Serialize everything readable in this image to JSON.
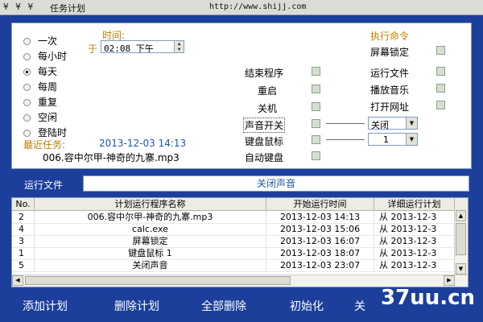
{
  "titlebar": {
    "icons_text": "¥ ¥ ¥",
    "title": "任务计划",
    "url": "http://www.shijj.com"
  },
  "schedule": {
    "time_label": "时间:",
    "at_label": "于",
    "time_value": "02:08 下午",
    "spin_up": "▲",
    "spin_down": "▼",
    "options": [
      {
        "label": "一次",
        "selected": false
      },
      {
        "label": "每小时",
        "selected": false
      },
      {
        "label": "每天",
        "selected": true
      },
      {
        "label": "每周",
        "selected": false
      },
      {
        "label": "重复",
        "selected": false
      },
      {
        "label": "空闲",
        "selected": false
      },
      {
        "label": "登陆时",
        "selected": false
      }
    ],
    "recent_label": "最近任务:",
    "recent_datetime": "2013-12-03   14:13",
    "recent_file": "006.容中尔甲-神奇的九寨.mp3"
  },
  "actions_mid": [
    {
      "label": "结束程序"
    },
    {
      "label": "重启"
    },
    {
      "label": "关机"
    },
    {
      "label": "声音开关"
    },
    {
      "label": "键盘鼠标"
    },
    {
      "label": "自动键盘"
    }
  ],
  "actions_right": {
    "header": "执行命令",
    "items": [
      {
        "label": "屏幕锁定"
      },
      {
        "label": "运行文件"
      },
      {
        "label": "播放音乐"
      },
      {
        "label": "打开网址"
      }
    ],
    "sound_select": "关闭",
    "kbd_select": "1",
    "dropdown_glyph": "▼"
  },
  "run_file": {
    "label": "运行文件",
    "value": "关闭声音"
  },
  "table": {
    "headers": [
      "No.",
      "计划运行程序名称",
      "开始运行时间",
      "详细运行计划"
    ],
    "rows": [
      {
        "no": "2",
        "name": "006.容中尔甲-神奇的九寨.mp3",
        "time": "2013-12-03   14:13",
        "detail": "从 2013-12-3"
      },
      {
        "no": "4",
        "name": "calc.exe",
        "time": "2013-12-03   15:06",
        "detail": "从 2013-12-3"
      },
      {
        "no": "3",
        "name": "屏幕锁定",
        "time": "2013-12-03   16:07",
        "detail": "从 2013-12-3"
      },
      {
        "no": "1",
        "name": "键盘鼠标 1",
        "time": "2013-12-03   18:07",
        "detail": "从 2013-12-3"
      },
      {
        "no": "5",
        "name": "关闭声音",
        "time": "2013-12-03   23:07",
        "detail": "从 2013-12-3"
      }
    ],
    "arrows": {
      "up": "▲",
      "down": "▼",
      "left": "◀",
      "right": "▶"
    }
  },
  "bottom_buttons": [
    "添加计划",
    "删除计划",
    "全部删除",
    "初始化",
    "关"
  ],
  "watermark": "37uu.cn"
}
